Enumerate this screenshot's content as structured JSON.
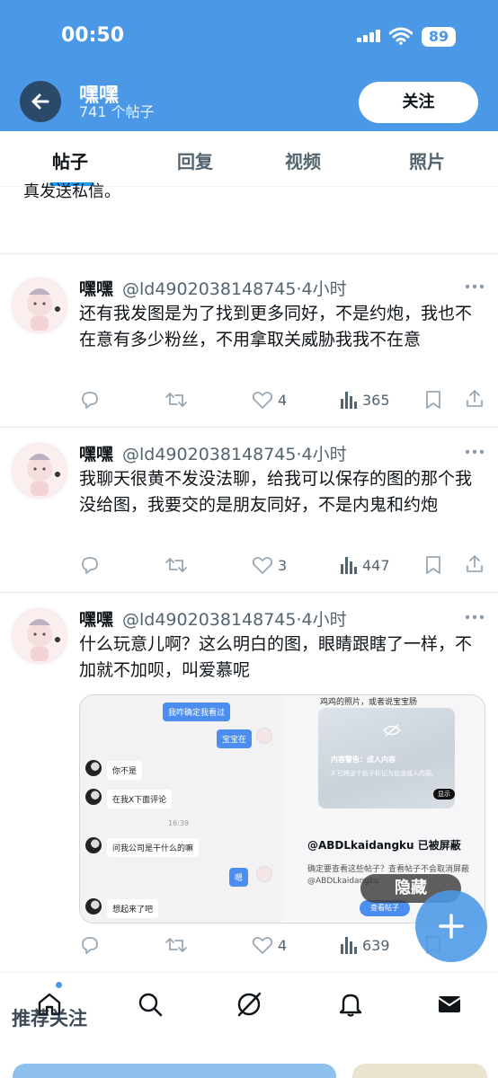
{
  "status_bar": {
    "time": "00:50",
    "battery": "89"
  },
  "header": {
    "name": "嘿嘿",
    "post_count": "741 个帖子",
    "follow_label": "关注"
  },
  "tabs": [
    {
      "label": "帖子",
      "active": true
    },
    {
      "label": "回复",
      "active": false
    },
    {
      "label": "视频",
      "active": false
    },
    {
      "label": "照片",
      "active": false
    }
  ],
  "partial_post_text": "真发送私信。",
  "posts": [
    {
      "name": "嘿嘿",
      "handle": "@ld4902038148745·4小时",
      "text": "还有我发图是为了找到更多同好，不是约炮，我也不在意有多少粉丝，不用拿取关威胁我我不在意",
      "likes": "4",
      "views": "365"
    },
    {
      "name": "嘿嘿",
      "handle": "@ld4902038148745·4小时",
      "text": "我聊天很黄不发没法聊，给我可以保存的图的那个我没给图，我要交的是朋友同好，不是内鬼和约炮",
      "likes": "3",
      "views": "447"
    },
    {
      "name": "嘿嘿",
      "handle": "@ld4902038148745·4小时",
      "text": "什么玩意儿啊？这么明白的图，眼睛跟瞎了一样，不加就不加呗，叫爱慕呢",
      "likes": "4",
      "views": "639"
    }
  ],
  "media": {
    "chat": {
      "msg1": "我咋确定我看过",
      "msg2": "宝宝在",
      "msg3": "你不是",
      "msg4": "在我X下面评论",
      "time": "16:39",
      "msg5": "问我公司是干什么的嘛",
      "msg6": "嗯",
      "msg7": "想起来了吧"
    },
    "right": {
      "top_text": "鸡鸡的照片，或者说宝宝肠",
      "warning_title": "内容警告：成人内容",
      "warning_sub": "X 已将这个帖子标记为包含成人内容。",
      "show_label": "显示",
      "blocked_title": "@ABDLkaidangku 已被屏蔽",
      "blocked_sub": "确定要查看这些帖子？查看帖子不会取消屏蔽 @ABDLkaidangku",
      "view_posts_label": "查看帖子",
      "hide_label": "隐藏"
    }
  },
  "bottom": {
    "recommended_label": "推荐关注"
  },
  "colors": {
    "header_bg": "#4a98e6",
    "accent": "#1d9bf0"
  }
}
